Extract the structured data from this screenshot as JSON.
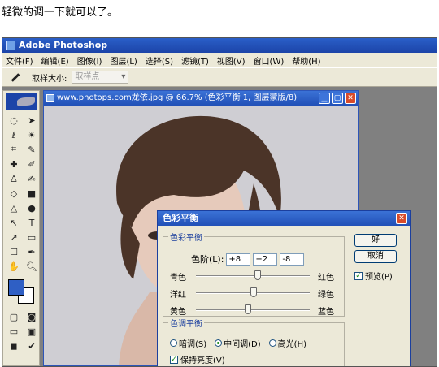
{
  "caption": "轻微的调一下就可以了。",
  "app": {
    "title": "Adobe Photoshop"
  },
  "menu": [
    "文件(F)",
    "编辑(E)",
    "图像(I)",
    "图层(L)",
    "选择(S)",
    "滤镜(T)",
    "视图(V)",
    "窗口(W)",
    "帮助(H)"
  ],
  "options": {
    "sample_label": "取样大小:",
    "sample_value": "取样点"
  },
  "document": {
    "title": "www.photops.com龙依.jpg @ 66.7% (色彩平衡 1, 图层蒙版/8)"
  },
  "dialog": {
    "title": "色彩平衡",
    "balance_group": "色彩平衡",
    "levels_label": "色阶(L):",
    "levels": [
      "+8",
      "+2",
      "-8"
    ],
    "sliders": [
      {
        "left": "青色",
        "right": "红色",
        "value": 8
      },
      {
        "left": "洋红",
        "right": "绿色",
        "value": 2
      },
      {
        "left": "黄色",
        "right": "蓝色",
        "value": -8
      }
    ],
    "tone_group": "色调平衡",
    "tones": [
      "暗调(S)",
      "中间调(D)",
      "高光(H)"
    ],
    "tone_selected": 1,
    "preserve_label": "保持亮度(V)",
    "ok_label": "好",
    "cancel_label": "取消",
    "preview_label": "预览(P)"
  },
  "colors": {
    "foreground": "#2f5fc4",
    "background": "#ffffff",
    "titlebar": "#2150b7"
  }
}
